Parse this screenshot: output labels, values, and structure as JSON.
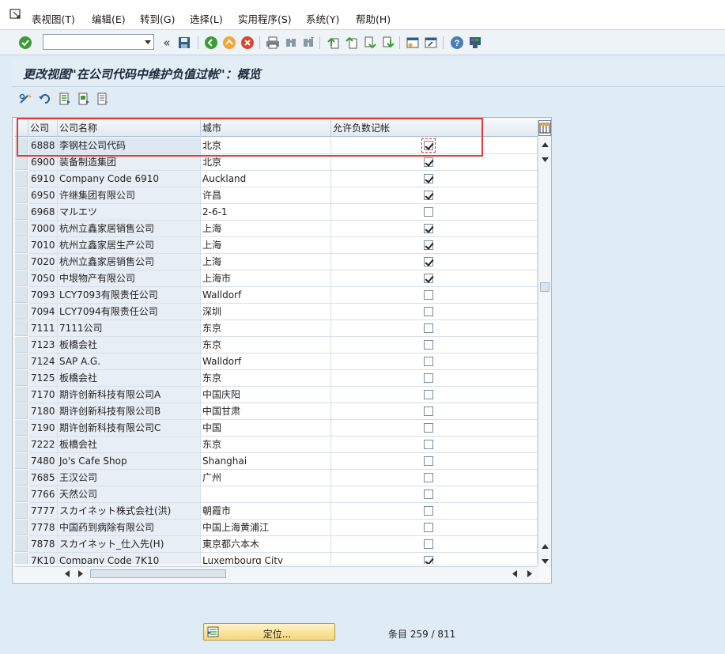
{
  "menu": {
    "items": [
      "表视图(T)",
      "编辑(E)",
      "转到(G)",
      "选择(L)",
      "实用程序(S)",
      "系统(Y)",
      "帮助(H)"
    ]
  },
  "toolbar": {
    "command_value": "",
    "icons": [
      "enter-check-icon",
      "save-icon",
      "back-icon",
      "exit-icon",
      "cancel-icon",
      "print-icon",
      "find-icon",
      "find-next-icon",
      "first-page-icon",
      "previous-page-icon",
      "next-page-icon",
      "last-page-icon",
      "new-session-icon",
      "shortcut-icon",
      "help-icon",
      "customize-layout-icon"
    ]
  },
  "title": "更改视图\"在公司代码中维护负值过帐\"：概览",
  "grid": {
    "columns": [
      "公司",
      "公司名称",
      "城市",
      "允许负数记帐"
    ],
    "rows": [
      {
        "code": "6888",
        "name": "李钢柱公司代码",
        "city": "北京",
        "neg": true
      },
      {
        "code": "6900",
        "name": "装备制造集团",
        "city": "北京",
        "neg": true
      },
      {
        "code": "6910",
        "name": "Company Code 6910",
        "city": "Auckland",
        "neg": true
      },
      {
        "code": "6950",
        "name": "许继集团有限公司",
        "city": "许昌",
        "neg": true
      },
      {
        "code": "6968",
        "name": "マルエツ",
        "city": "2-6-1",
        "neg": false
      },
      {
        "code": "7000",
        "name": "杭州立鑫家居销售公司",
        "city": "上海",
        "neg": true
      },
      {
        "code": "7010",
        "name": "杭州立鑫家居生产公司",
        "city": "上海",
        "neg": true
      },
      {
        "code": "7020",
        "name": "杭州立鑫家居销售公司",
        "city": "上海",
        "neg": true
      },
      {
        "code": "7050",
        "name": "中垠物产有限公司",
        "city": "上海市",
        "neg": true
      },
      {
        "code": "7093",
        "name": "LCY7093有限责任公司",
        "city": "Walldorf",
        "neg": false
      },
      {
        "code": "7094",
        "name": "LCY7094有限责任公司",
        "city": "深圳",
        "neg": false
      },
      {
        "code": "7111",
        "name": "7111公司",
        "city": "东京",
        "neg": false
      },
      {
        "code": "7123",
        "name": "板橋会社",
        "city": "东京",
        "neg": false
      },
      {
        "code": "7124",
        "name": "SAP A.G.",
        "city": "Walldorf",
        "neg": false
      },
      {
        "code": "7125",
        "name": "板橋会社",
        "city": "东京",
        "neg": false
      },
      {
        "code": "7170",
        "name": "期许创新科技有限公司A",
        "city": "中国庆阳",
        "neg": false
      },
      {
        "code": "7180",
        "name": "期许创新科技有限公司B",
        "city": "中国甘肃",
        "neg": false
      },
      {
        "code": "7190",
        "name": "期许创新科技有限公司C",
        "city": "中国",
        "neg": false
      },
      {
        "code": "7222",
        "name": "板橋会社",
        "city": "东京",
        "neg": false
      },
      {
        "code": "7480",
        "name": "Jo's Cafe Shop",
        "city": "Shanghai",
        "neg": false
      },
      {
        "code": "7685",
        "name": "王汉公司",
        "city": "广州",
        "neg": false
      },
      {
        "code": "7766",
        "name": "天然公司",
        "city": "",
        "neg": false
      },
      {
        "code": "7777",
        "name": "スカイネット株式会社(洪)",
        "city": "朝霞市",
        "neg": false
      },
      {
        "code": "7778",
        "name": "中国药到病除有限公司",
        "city": "中国上海黄浦江",
        "neg": false
      },
      {
        "code": "7878",
        "name": "スカイネット_仕入先(H)",
        "city": "東京都六本木",
        "neg": false
      },
      {
        "code": "7K10",
        "name": "Company Code 7K10",
        "city": "Luxembourg City",
        "neg": true
      }
    ]
  },
  "footer": {
    "position_button": "定位...",
    "entry_count": "条目 259 / 811"
  },
  "colors": {
    "highlight_border": "#e03c3c",
    "position_button": "#f4d77a"
  }
}
